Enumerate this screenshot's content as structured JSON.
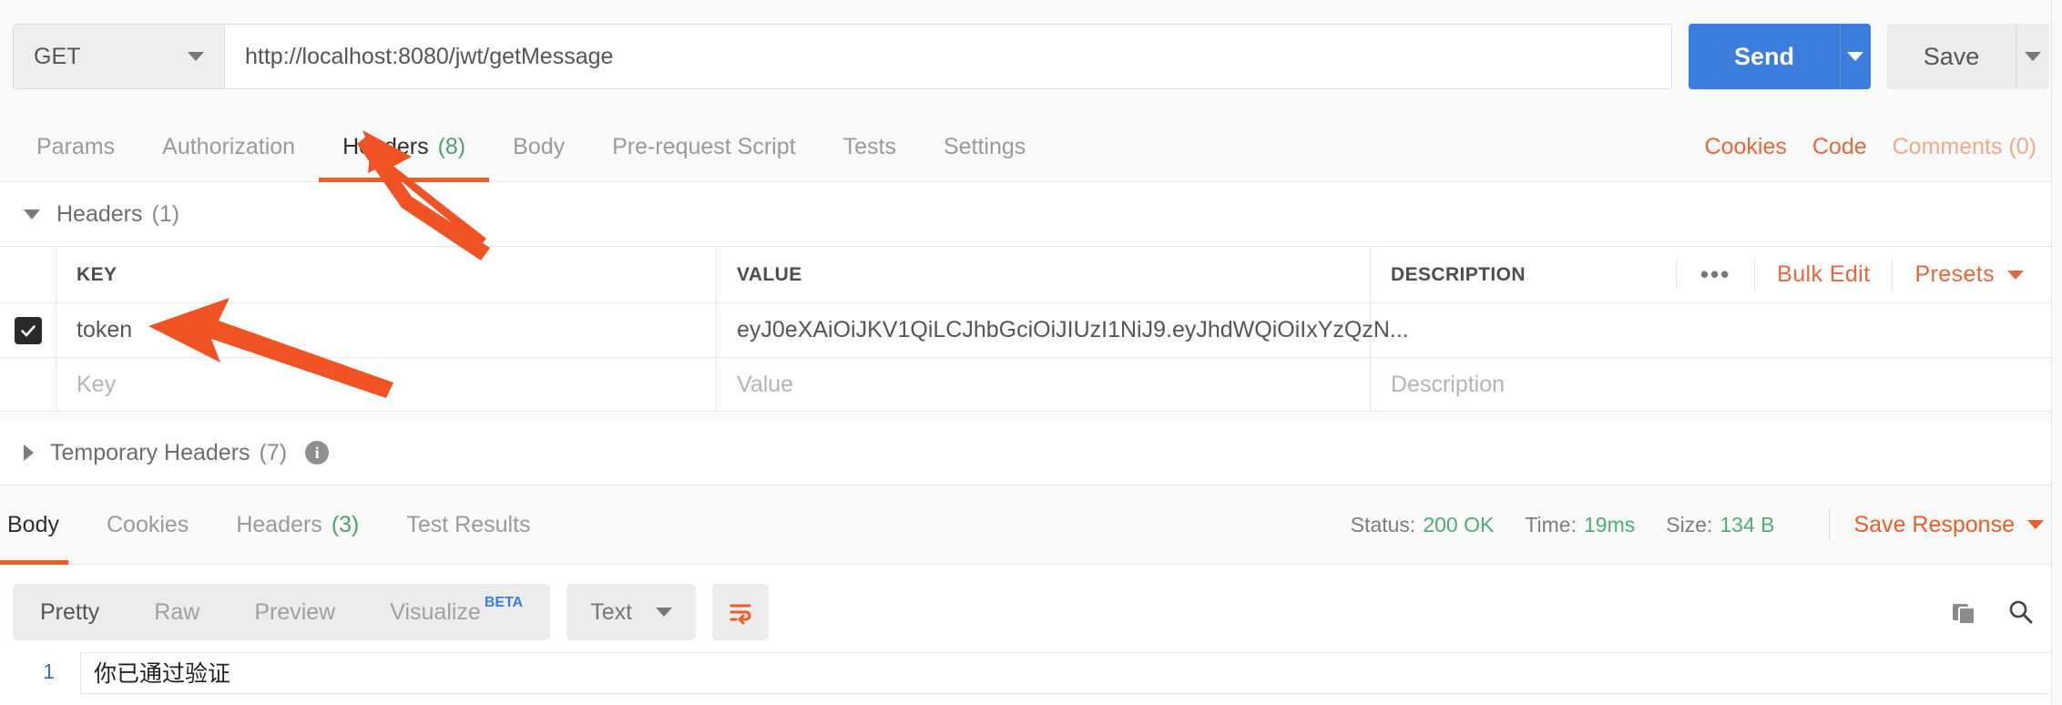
{
  "request": {
    "method": "GET",
    "url": "http://localhost:8080/jwt/getMessage",
    "send_label": "Send",
    "save_label": "Save"
  },
  "request_tabs": [
    {
      "label": "Params",
      "count": ""
    },
    {
      "label": "Authorization",
      "count": ""
    },
    {
      "label": "Headers",
      "count": "(8)"
    },
    {
      "label": "Body",
      "count": ""
    },
    {
      "label": "Pre-request Script",
      "count": ""
    },
    {
      "label": "Tests",
      "count": ""
    },
    {
      "label": "Settings",
      "count": ""
    }
  ],
  "request_links": {
    "cookies": "Cookies",
    "code": "Code",
    "comments": "Comments (0)"
  },
  "headers_section": {
    "title": "Headers",
    "count": "(1)",
    "columns": {
      "key": "KEY",
      "value": "VALUE",
      "description": "DESCRIPTION"
    },
    "tools": {
      "more": "•••",
      "bulk_edit": "Bulk Edit",
      "presets": "Presets"
    },
    "rows": [
      {
        "checked": true,
        "key": "token",
        "value": "eyJ0eXAiOiJKV1QiLCJhbGciOiJIUzI1NiJ9.eyJhdWQiOiIxYzQzN...",
        "description": ""
      }
    ],
    "placeholders": {
      "key": "Key",
      "value": "Value",
      "description": "Description"
    }
  },
  "temporary_headers": {
    "title": "Temporary Headers",
    "count": "(7)",
    "info_glyph": "i"
  },
  "response_tabs": [
    {
      "label": "Body",
      "count": ""
    },
    {
      "label": "Cookies",
      "count": ""
    },
    {
      "label": "Headers",
      "count": "(3)"
    },
    {
      "label": "Test Results",
      "count": ""
    }
  ],
  "response_meta": {
    "status_label": "Status:",
    "status_value": "200 OK",
    "time_label": "Time:",
    "time_value": "19ms",
    "size_label": "Size:",
    "size_value": "134 B",
    "save_response": "Save Response"
  },
  "viewer": {
    "modes": [
      "Pretty",
      "Raw",
      "Preview",
      "Visualize"
    ],
    "beta_badge": "BETA",
    "format": "Text",
    "line_number": "1",
    "body_text": "你已通过验证"
  },
  "colors": {
    "accent_orange": "#ef5b25",
    "link_orange": "#e8673a",
    "send_blue": "#3b7ddd",
    "status_green": "#4caf71",
    "count_green": "#49a46b",
    "arrow_red": "#ef5223"
  }
}
